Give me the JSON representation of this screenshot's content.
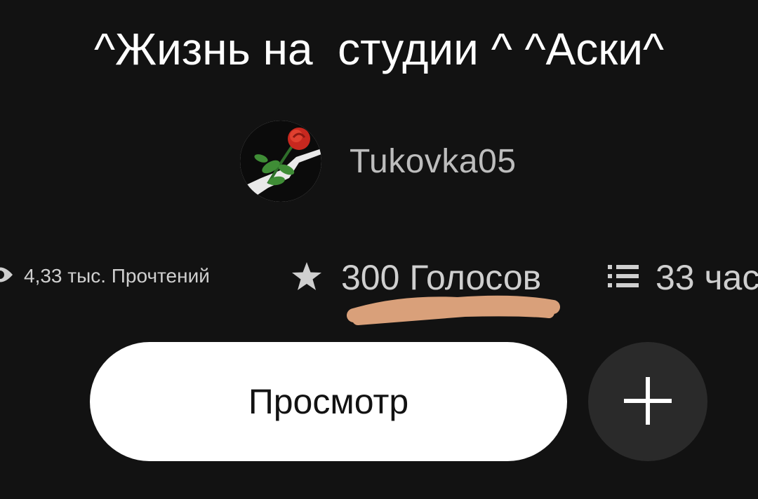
{
  "story": {
    "title": "^Жизнь на  студии ^ ^Аски^",
    "author": "Tukovka05"
  },
  "stats": {
    "reads_label": "4,33 тыс. Прочтений",
    "votes_label": "300 Голосов",
    "parts_label": "33 час"
  },
  "actions": {
    "view_label": "Просмотр",
    "add_icon": "plus-icon"
  },
  "icons": {
    "reads": "eye-icon",
    "votes": "star-icon",
    "parts": "list-icon"
  },
  "colors": {
    "background": "#121212",
    "text_primary": "#ffffff",
    "text_secondary": "#bdbdbd",
    "button_primary": "#ffffff",
    "button_secondary": "#2a2a2a",
    "highlight_mark": "#d9a07a"
  }
}
